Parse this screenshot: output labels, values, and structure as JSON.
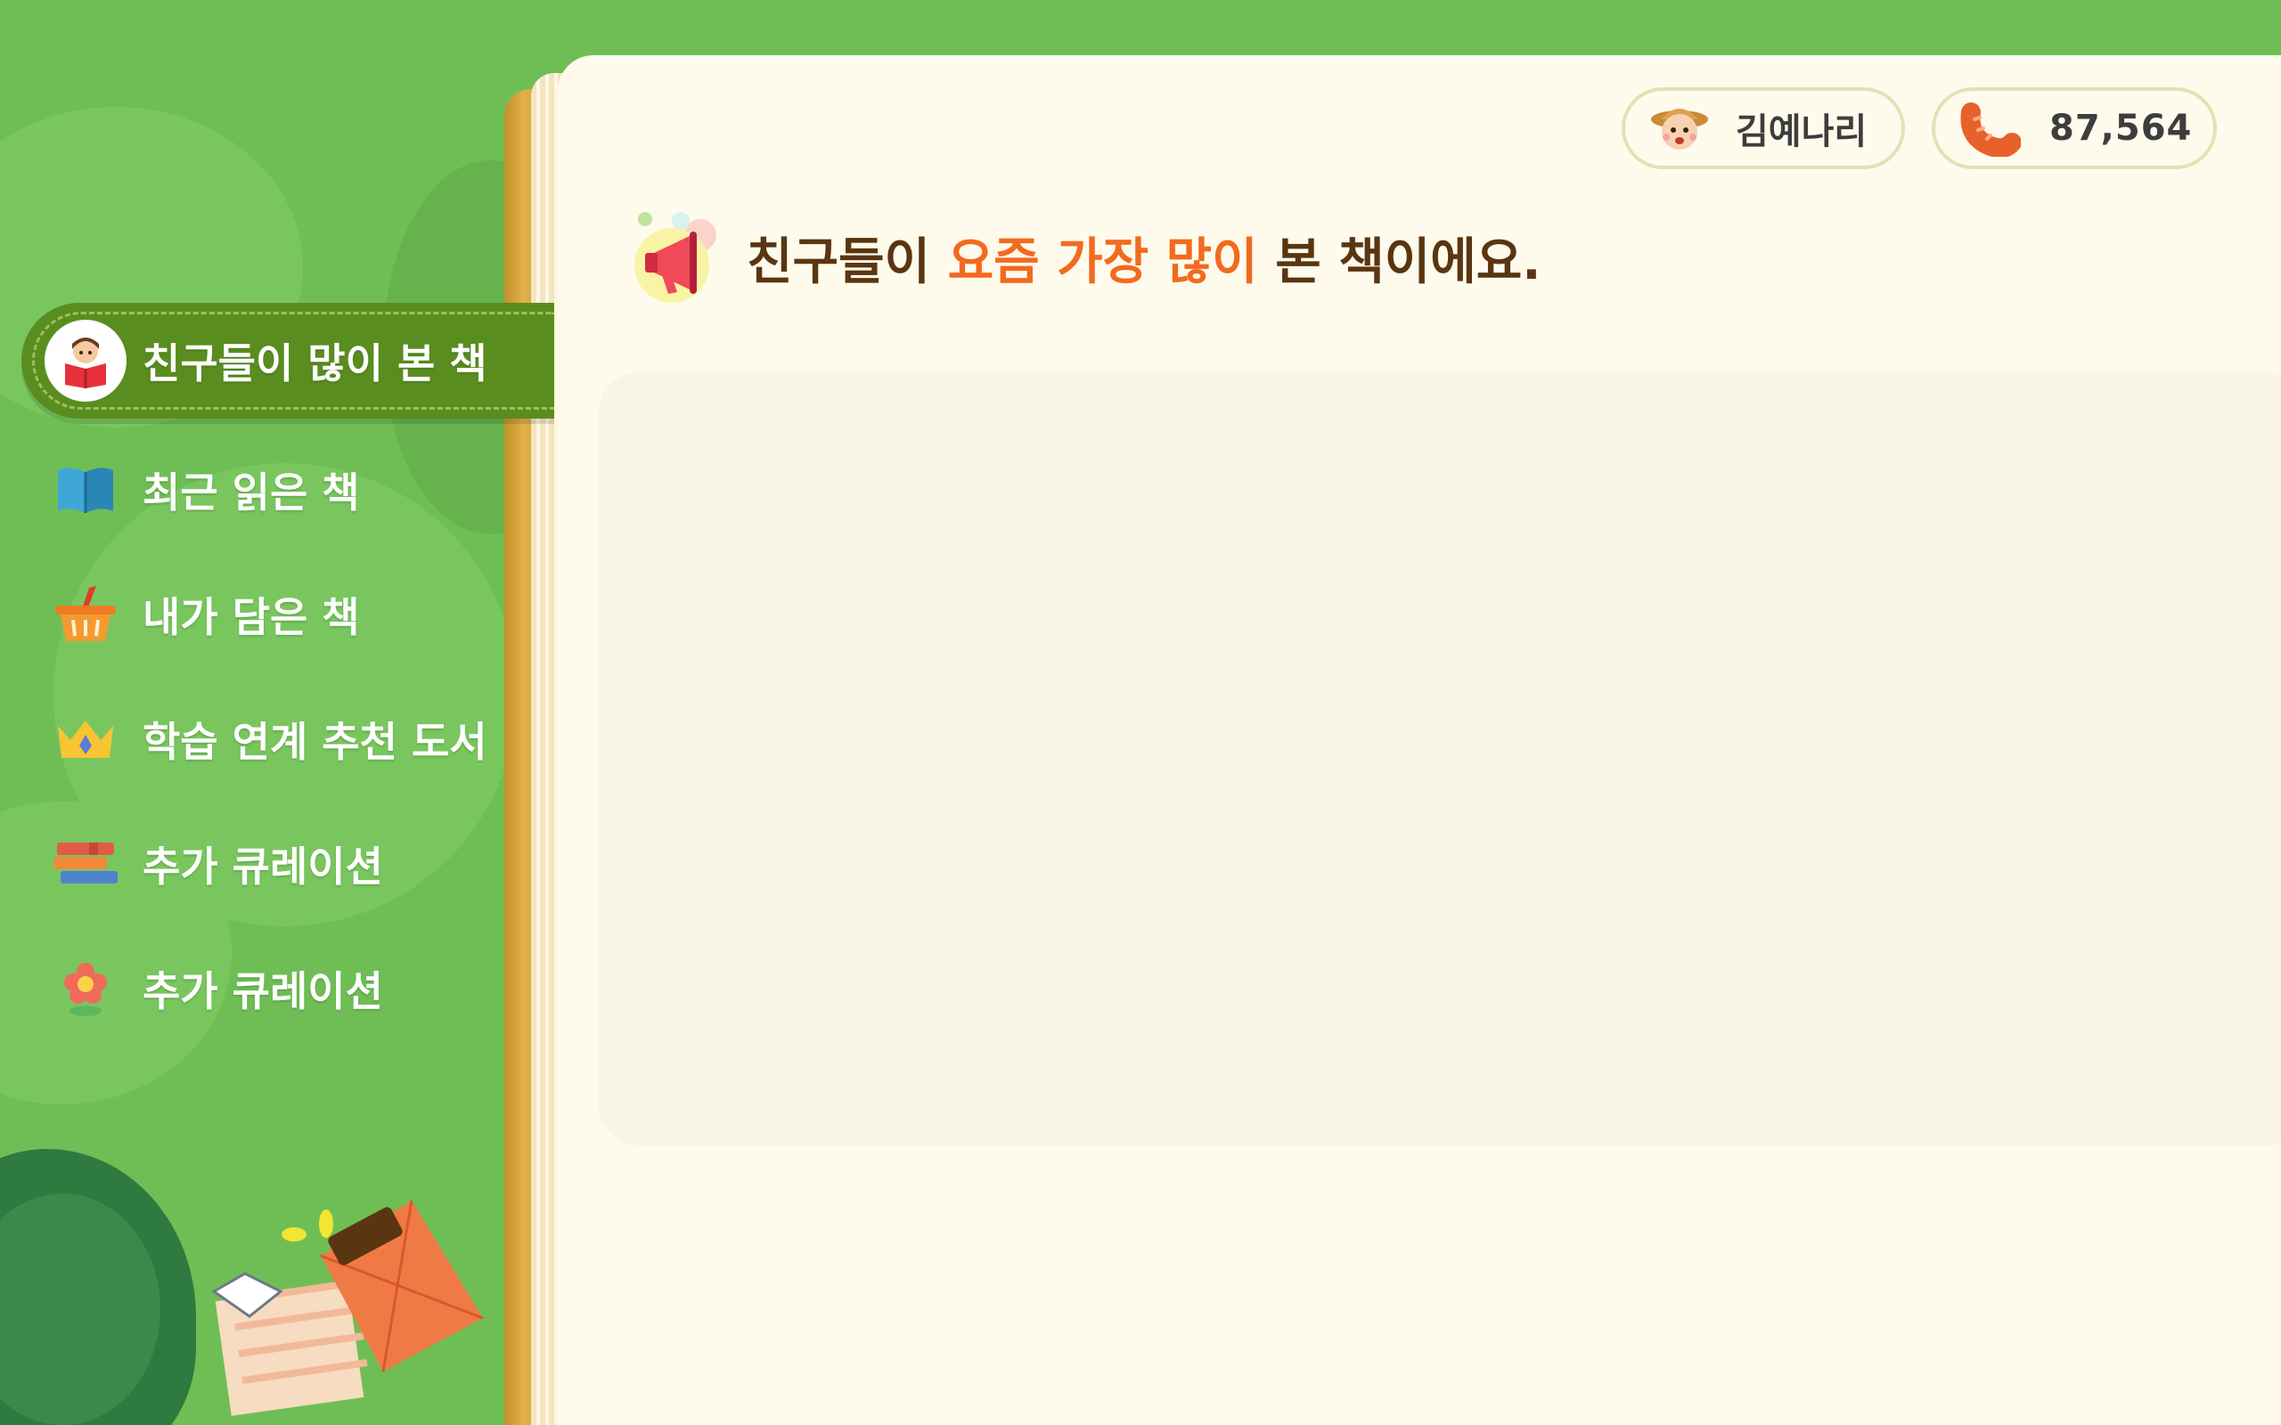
{
  "sidebar": {
    "items": [
      {
        "label": "친구들이 많이 본 책",
        "icon": "reading-kid-icon",
        "active": true
      },
      {
        "label": "최근 읽은 책",
        "icon": "open-book-icon",
        "active": false
      },
      {
        "label": "내가 담은 책",
        "icon": "basket-icon",
        "active": false
      },
      {
        "label": "학습 연계 추천 도서",
        "icon": "crown-icon",
        "active": false
      },
      {
        "label": "추가 큐레이션",
        "icon": "book-stack-icon",
        "active": false
      },
      {
        "label": "추가 큐레이션",
        "icon": "flower-icon",
        "active": false
      }
    ]
  },
  "header": {
    "user_name": "김예나리",
    "user_icon": "boy-avatar-icon",
    "points": "87,564",
    "points_icon": "sausage-icon"
  },
  "main": {
    "heading_parts": [
      "친구들이 ",
      "요즘 가장 많이",
      " 본 책이에요."
    ],
    "heading_icon": "megaphone-icon"
  },
  "colors": {
    "grass": "#6fbe55",
    "active_tab": "#5a8d1f",
    "page": "#fefbec",
    "heading_text": "#5a3512",
    "heading_highlight": "#f26a1f"
  }
}
